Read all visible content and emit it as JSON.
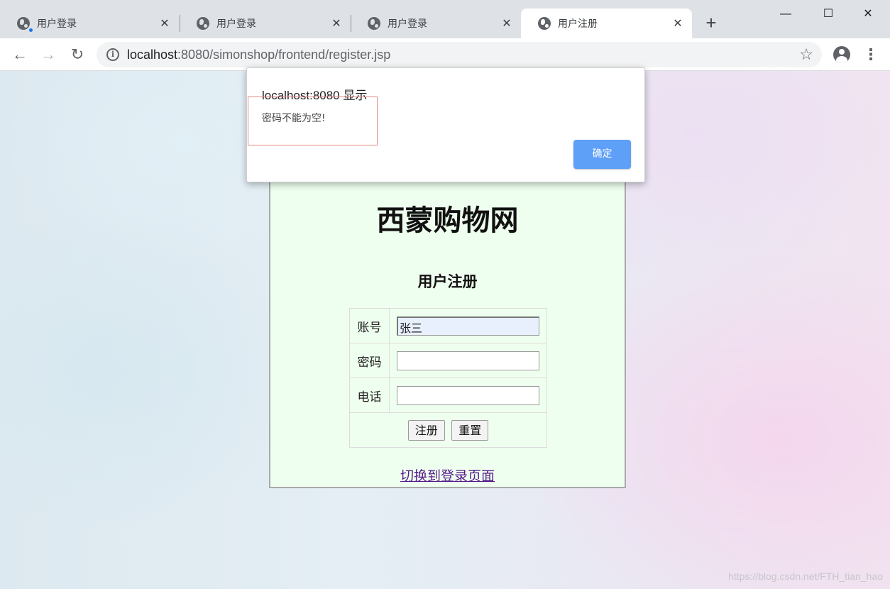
{
  "browser": {
    "tabs": [
      {
        "title": "用户登录",
        "active": false,
        "loading_dot": true
      },
      {
        "title": "用户登录",
        "active": false,
        "loading_dot": false
      },
      {
        "title": "用户登录",
        "active": false,
        "loading_dot": false
      },
      {
        "title": "用户注册",
        "active": true,
        "loading_dot": false
      }
    ],
    "tab_close_glyph": "✕",
    "new_tab_glyph": "+",
    "window_controls": {
      "minimize": "—",
      "maximize": "☐",
      "close": "✕"
    },
    "nav": {
      "back_glyph": "←",
      "forward_glyph": "→",
      "reload_glyph": "↻"
    },
    "address": {
      "host": "localhost",
      "rest": ":8080/simonshop/frontend/register.jsp"
    },
    "info_glyph": "i",
    "bookmark_glyph": "☆",
    "menu_glyph": "⋮"
  },
  "page": {
    "site_title": "西蒙购物网",
    "form_title": "用户注册",
    "fields": [
      {
        "label": "账号",
        "value": "张三"
      },
      {
        "label": "密码",
        "value": ""
      },
      {
        "label": "电话",
        "value": ""
      }
    ],
    "buttons": {
      "submit": "注册",
      "reset": "重置"
    },
    "switch_link": "切换到登录页面",
    "watermark": "https://blog.csdn.net/FTH_tian_hao"
  },
  "dialog": {
    "title": "localhost:8080 显示",
    "message": "密码不能为空!",
    "ok_label": "确定"
  },
  "colors": {
    "panel_bg": "#efffef",
    "ok_button": "#5e9ff8",
    "link": "#551a8b",
    "highlight_box": "#e58787"
  },
  "icons": [
    "globe-icon",
    "close-icon",
    "plus-icon",
    "back-icon",
    "forward-icon",
    "reload-icon",
    "info-icon",
    "star-icon",
    "account-icon",
    "menu-icon"
  ]
}
